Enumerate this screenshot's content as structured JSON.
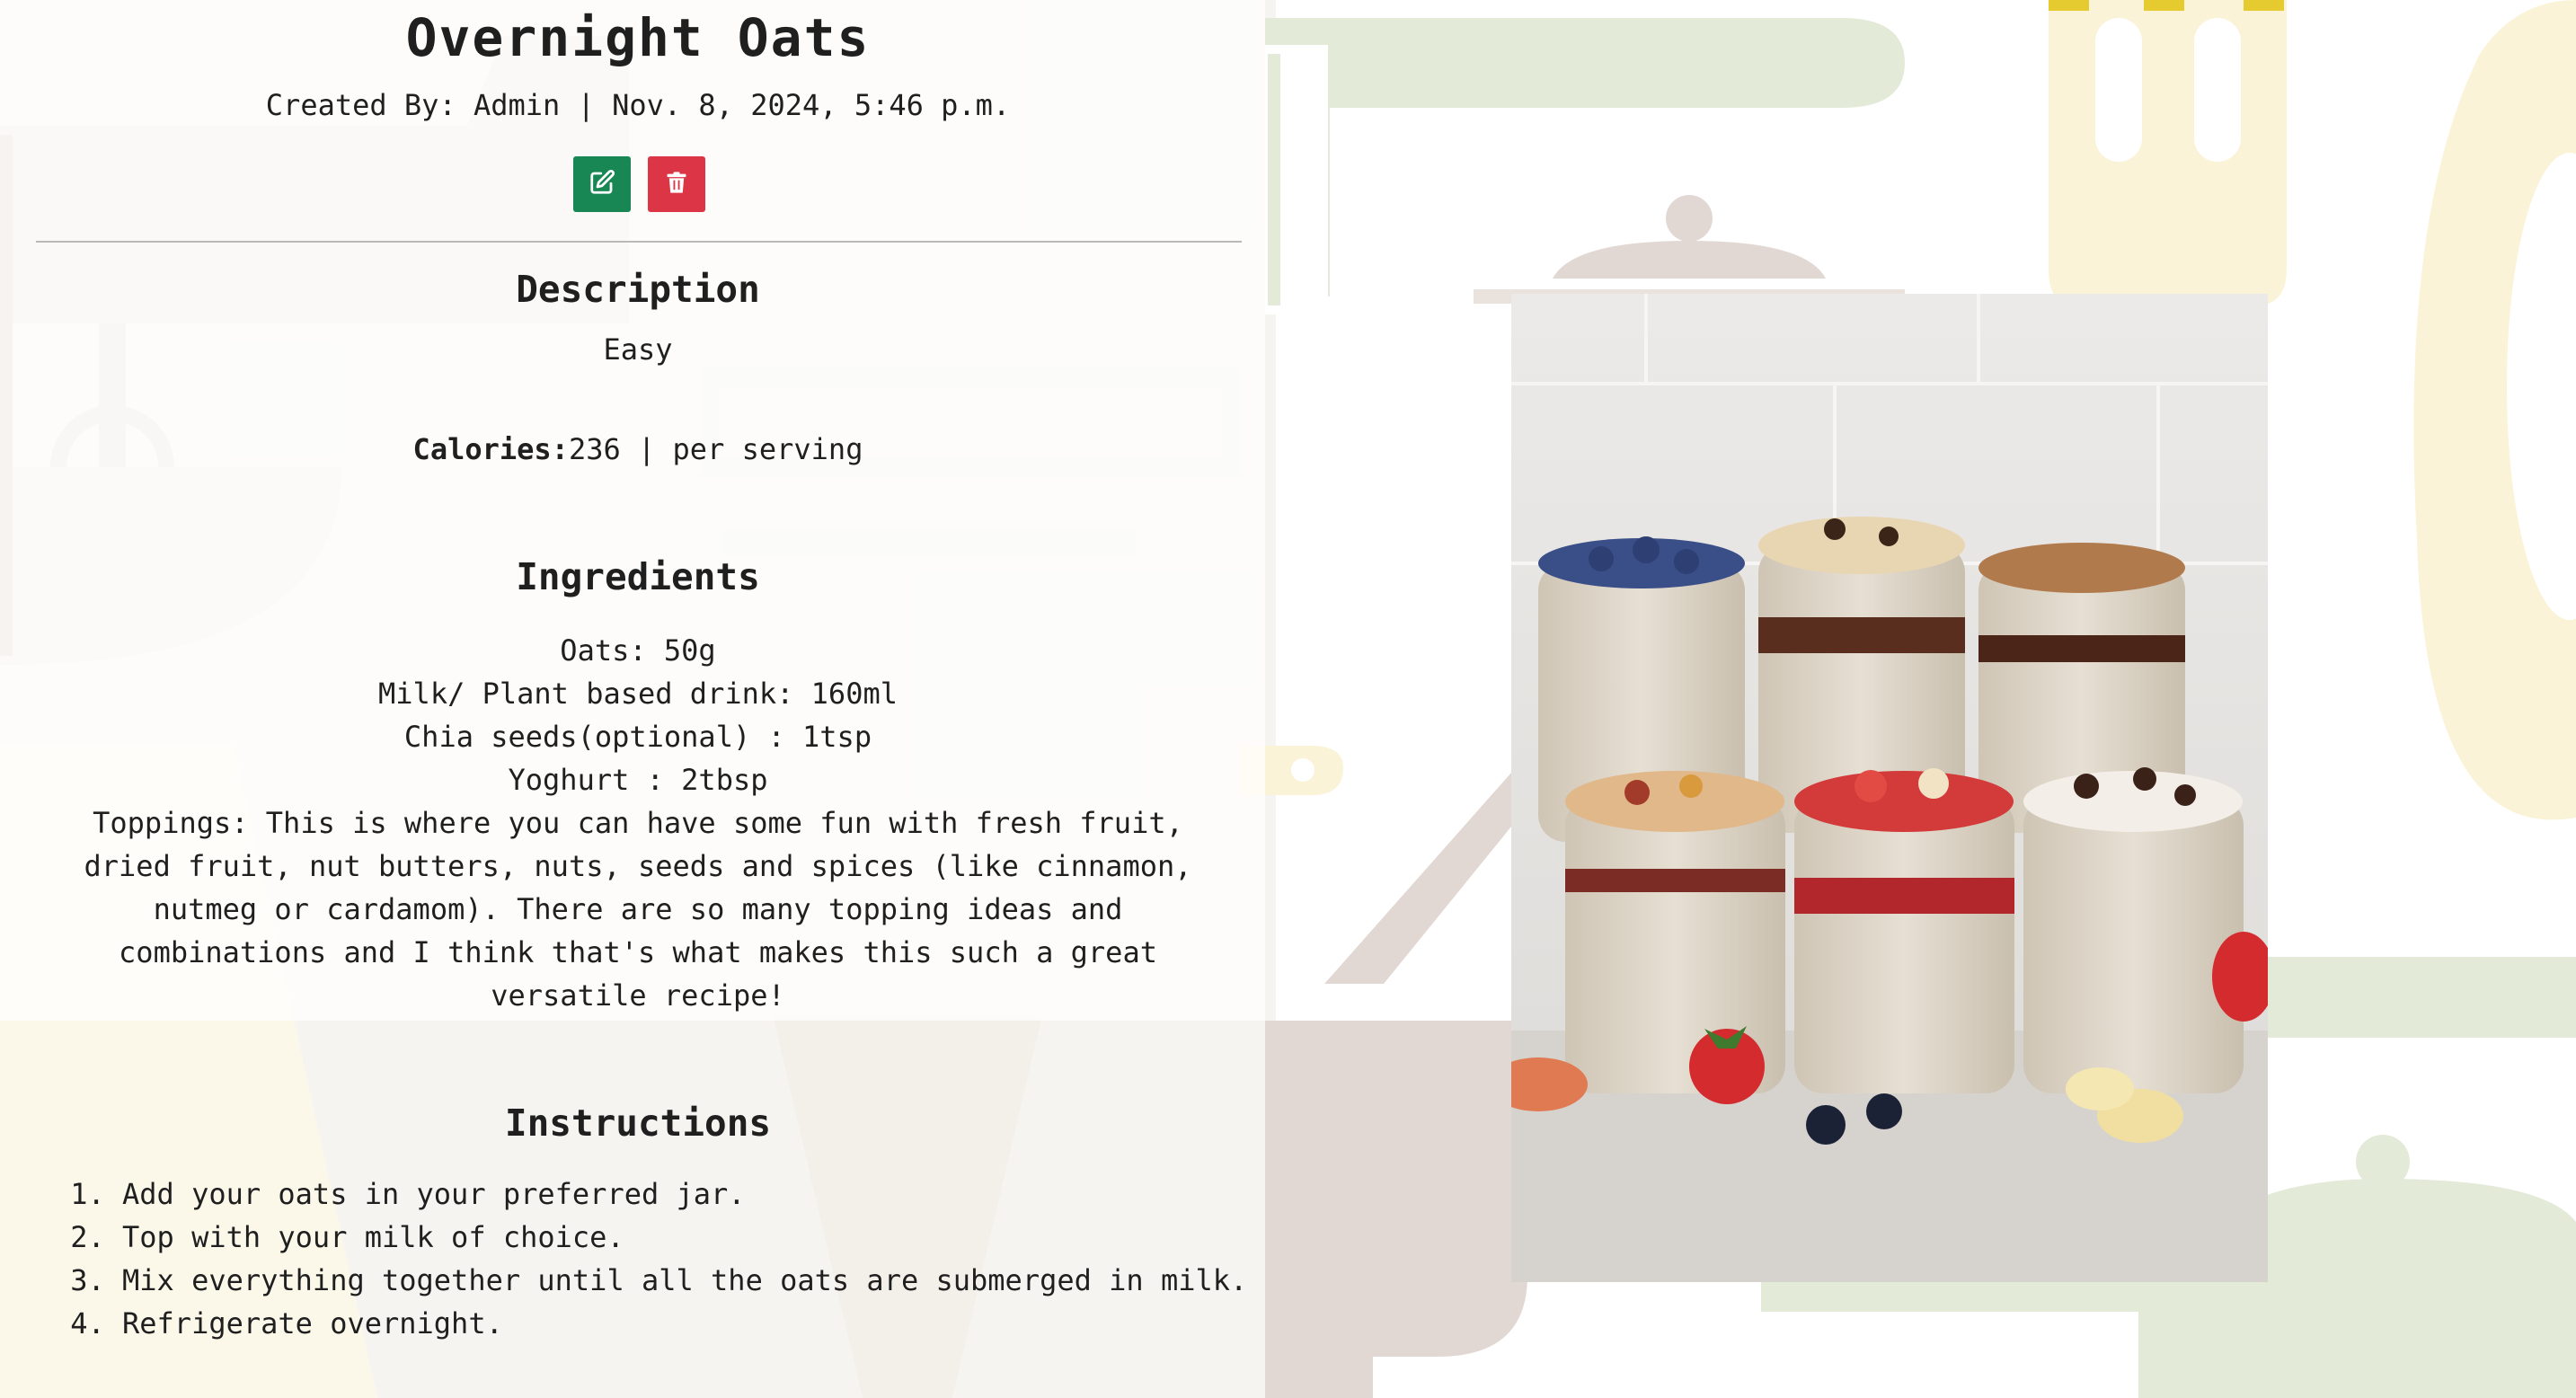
{
  "recipe": {
    "title": "Overnight Oats",
    "meta": "Created By: Admin | Nov. 8, 2024, 5:46 p.m.",
    "actions": {
      "edit_icon": "edit-icon",
      "delete_icon": "trash-icon"
    },
    "description": {
      "heading": "Description",
      "text": "Easy",
      "calories_label": "Calories:",
      "calories_value": "236 | per serving"
    },
    "ingredients": {
      "heading": "Ingredients",
      "items": [
        "Oats: 50g",
        "Milk/ Plant based drink: 160ml",
        "Chia seeds(optional) : 1tsp",
        "Yoghurt : 2tbsp",
        "Toppings: This is where you can have some fun with fresh fruit, dried fruit, nut butters, nuts, seeds and spices (like cinnamon, nutmeg or cardamom). There are so many topping ideas and combinations and I think that's what makes this such a great versatile recipe!"
      ]
    },
    "instructions": {
      "heading": "Instructions",
      "steps": [
        "Add your oats in your preferred jar.",
        "Top with your milk of choice.",
        "Mix everything together until all the oats are submerged in milk.",
        "Refrigerate overnight."
      ]
    }
  },
  "colors": {
    "edit_button": "#198754",
    "delete_button": "#dc3545",
    "bg_green": "#e4ead8",
    "bg_yellow": "#faf3d8",
    "bg_beige": "#e2d8d3",
    "bg_grey": "#f1efec"
  }
}
